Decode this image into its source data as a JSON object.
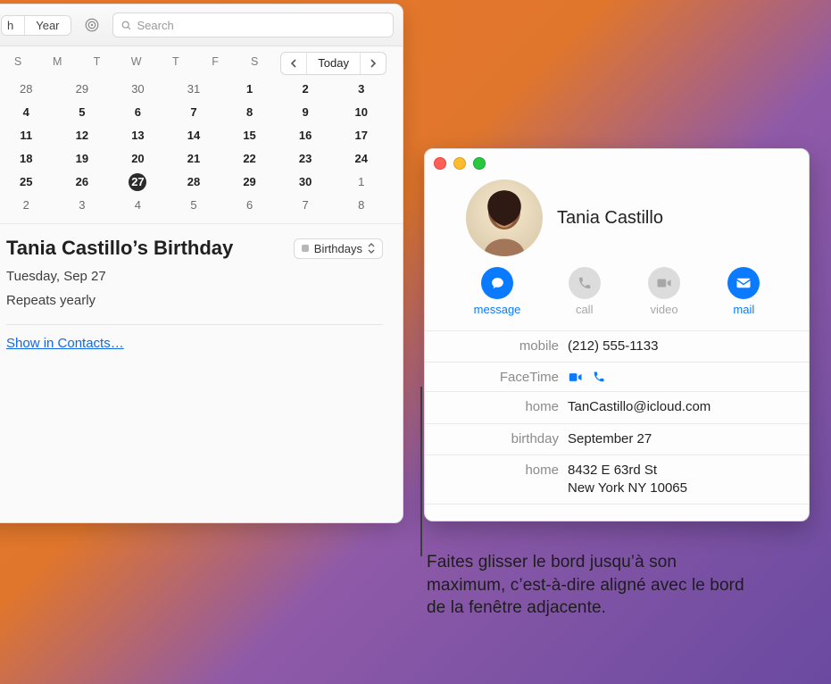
{
  "calendar": {
    "toolbar": {
      "view_seg_left": "h",
      "view_seg_right": "Year",
      "search_placeholder": "Search"
    },
    "mini": {
      "dow": [
        "S",
        "M",
        "T",
        "W",
        "T",
        "F",
        "S"
      ],
      "today_label": "Today",
      "weeks": [
        [
          {
            "n": "28",
            "in": false
          },
          {
            "n": "29",
            "in": false
          },
          {
            "n": "30",
            "in": false
          },
          {
            "n": "31",
            "in": false
          },
          {
            "n": "1",
            "in": true
          },
          {
            "n": "2",
            "in": true
          },
          {
            "n": "3",
            "in": true
          }
        ],
        [
          {
            "n": "4",
            "in": true
          },
          {
            "n": "5",
            "in": true
          },
          {
            "n": "6",
            "in": true
          },
          {
            "n": "7",
            "in": true
          },
          {
            "n": "8",
            "in": true
          },
          {
            "n": "9",
            "in": true
          },
          {
            "n": "10",
            "in": true
          }
        ],
        [
          {
            "n": "11",
            "in": true
          },
          {
            "n": "12",
            "in": true
          },
          {
            "n": "13",
            "in": true
          },
          {
            "n": "14",
            "in": true
          },
          {
            "n": "15",
            "in": true
          },
          {
            "n": "16",
            "in": true
          },
          {
            "n": "17",
            "in": true
          }
        ],
        [
          {
            "n": "18",
            "in": true
          },
          {
            "n": "19",
            "in": true
          },
          {
            "n": "20",
            "in": true
          },
          {
            "n": "21",
            "in": true
          },
          {
            "n": "22",
            "in": true
          },
          {
            "n": "23",
            "in": true
          },
          {
            "n": "24",
            "in": true
          }
        ],
        [
          {
            "n": "25",
            "in": true
          },
          {
            "n": "26",
            "in": true
          },
          {
            "n": "27",
            "in": true,
            "sel": true
          },
          {
            "n": "28",
            "in": true
          },
          {
            "n": "29",
            "in": true
          },
          {
            "n": "30",
            "in": true
          },
          {
            "n": "1",
            "in": false
          }
        ],
        [
          {
            "n": "2",
            "in": false
          },
          {
            "n": "3",
            "in": false
          },
          {
            "n": "4",
            "in": false
          },
          {
            "n": "5",
            "in": false
          },
          {
            "n": "6",
            "in": false
          },
          {
            "n": "7",
            "in": false
          },
          {
            "n": "8",
            "in": false
          }
        ]
      ]
    },
    "event": {
      "title": "Tania Castillo’s Birthday",
      "calendar_name": "Birthdays",
      "date": "Tuesday, Sep 27",
      "repeat": "Repeats yearly",
      "show_contacts": "Show in Contacts…"
    }
  },
  "contact": {
    "name": "Tania Castillo",
    "actions": {
      "message": "message",
      "call": "call",
      "video": "video",
      "mail": "mail"
    },
    "fields": {
      "mobile_label": "mobile",
      "mobile_value": "(212) 555-1133",
      "facetime_label": "FaceTime",
      "home_email_label": "home",
      "home_email_value": "TanCastillo@icloud.com",
      "birthday_label": "birthday",
      "birthday_value": "September 27",
      "home_addr_label": "home",
      "home_addr_value": "8432 E 63rd St\nNew York NY 10065"
    }
  },
  "callout": {
    "text": "Faites glisser le bord jusqu’à son maximum, c’est-à-dire aligné avec le bord de la fenêtre adjacente."
  }
}
